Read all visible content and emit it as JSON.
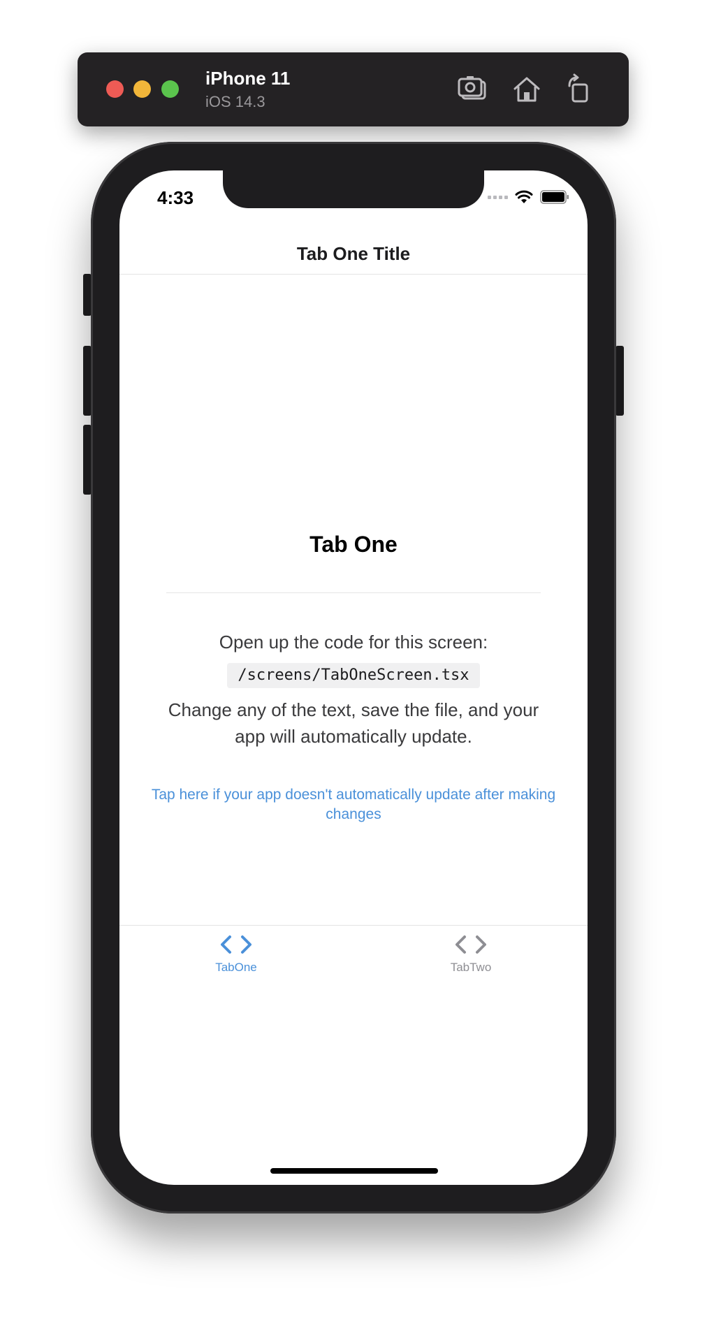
{
  "simulator": {
    "device_name": "iPhone 11",
    "os_version": "iOS 14.3",
    "buttons": [
      "screenshot-icon",
      "home-icon",
      "rotate-icon"
    ]
  },
  "status_bar": {
    "time": "4:33"
  },
  "header": {
    "title": "Tab One Title"
  },
  "main": {
    "heading": "Tab One",
    "intro": "Open up the code for this screen:",
    "code_path": "/screens/TabOneScreen.tsx",
    "description": "Change any of the text, save the file, and your app will automatically update.",
    "help_link": "Tap here if your app doesn't automatically update after making changes"
  },
  "tabs": [
    {
      "label": "TabOne",
      "icon": "code-icon",
      "active": true
    },
    {
      "label": "TabTwo",
      "icon": "code-icon",
      "active": false
    }
  ],
  "colors": {
    "accent": "#4a90d9",
    "inactive": "#8e8e93",
    "frame": "#1e1d1f"
  }
}
